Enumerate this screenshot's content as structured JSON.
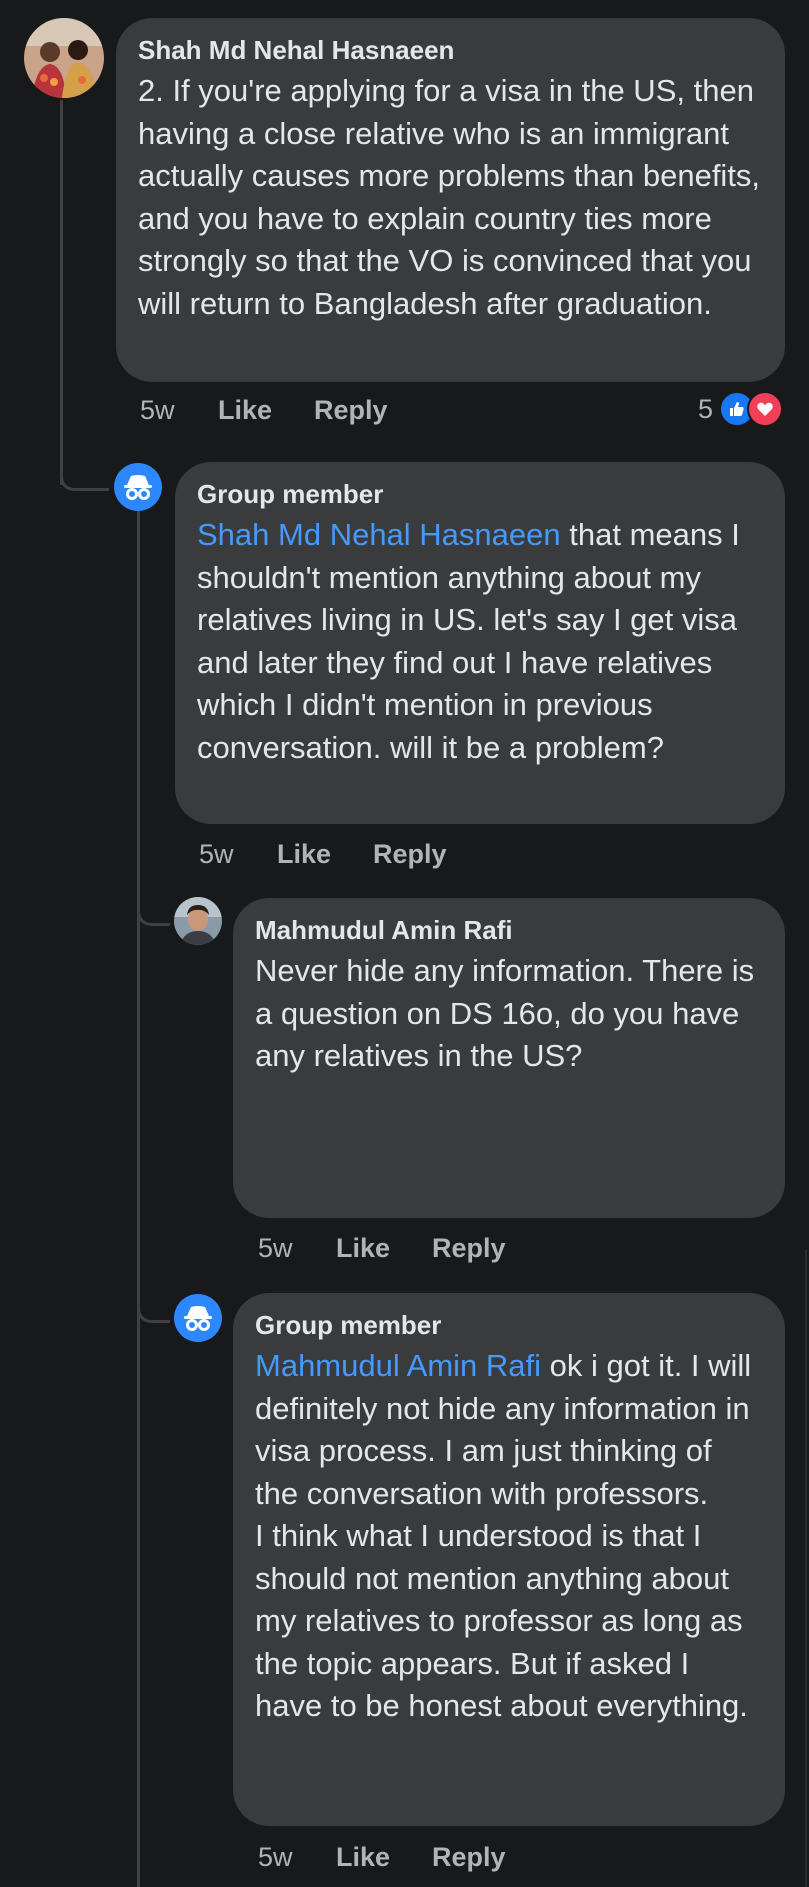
{
  "comments": [
    {
      "author": "Shah Md Nehal Hasnaeen",
      "text": "2. If you're applying for a visa in the US, then having a close relative who is an immigrant actually causes more problems than benefits, and you have to explain country ties more strongly so that the VO is convinced that you will return to Bangladesh after graduation.",
      "time": "5w",
      "like": "Like",
      "reply": "Reply",
      "reaction_count": "5"
    },
    {
      "author": "Group member",
      "mention": "Shah Md Nehal Hasnaeen",
      "text": " that means I shouldn't mention anything about my relatives living in US. let's say I get visa and later they find out I have relatives which I didn't mention in previous conversation. will it be a problem?",
      "time": "5w",
      "like": "Like",
      "reply": "Reply"
    },
    {
      "author": "Mahmudul Amin Rafi",
      "text": "Never hide any information. There is a question on DS 16o, do you have any relatives in the US?",
      "time": "5w",
      "like": "Like",
      "reply": "Reply"
    },
    {
      "author": "Group member",
      "mention": "Mahmudul Amin Rafi",
      "text": " ok i got it. I will definitely not hide any information in visa process. I am just thinking of the conversation with professors.\nI think what I understood is that I should not mention anything about my relatives to professor as long as the topic appears. But if asked I have to be honest about everything.",
      "time": "5w",
      "like": "Like",
      "reply": "Reply"
    }
  ],
  "colors": {
    "background": "#18191a",
    "bubble": "#3a3b3c",
    "mention": "#4599ff",
    "like_icon": "#1877f2",
    "love_icon": "#f33e58",
    "anon_avatar": "#2d88ff"
  },
  "icons": [
    "profile-photo",
    "anonymous-member-icon",
    "like-reaction-icon",
    "love-reaction-icon"
  ]
}
